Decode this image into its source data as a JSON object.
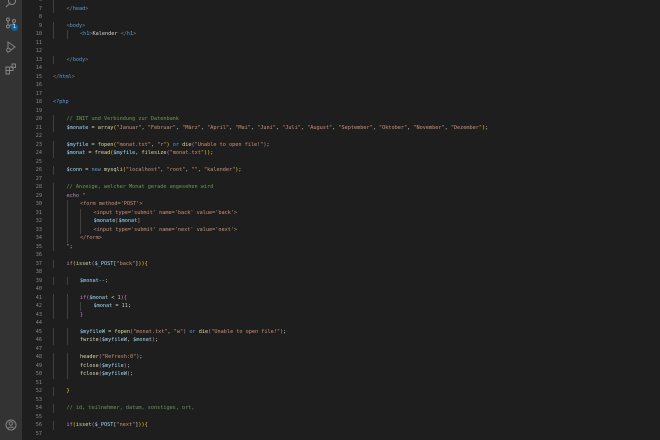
{
  "activity_bar": {
    "icons": [
      "search-icon",
      "source-control-icon",
      "run-debug-icon",
      "extensions-icon",
      "account-icon"
    ],
    "source_control_badge": "1"
  },
  "editor": {
    "language": "php",
    "lines": [
      {
        "n": "6",
        "indent": 1,
        "tokens": [
          [
            "",
            "t-default"
          ]
        ]
      },
      {
        "n": "7",
        "indent": 1,
        "tokens": [
          [
            "</",
            "t-punct"
          ],
          [
            "head",
            "t-tag"
          ],
          [
            ">",
            "t-punct"
          ]
        ]
      },
      {
        "n": "8",
        "indent": 0,
        "tokens": [
          [
            "",
            "t-default"
          ]
        ]
      },
      {
        "n": "9",
        "indent": 1,
        "tokens": [
          [
            "<",
            "t-punct"
          ],
          [
            "body",
            "t-tag"
          ],
          [
            ">",
            "t-punct"
          ]
        ]
      },
      {
        "n": "10",
        "indent": 2,
        "tokens": [
          [
            "<",
            "t-punct"
          ],
          [
            "h1",
            "t-tag"
          ],
          [
            ">",
            "t-punct"
          ],
          [
            "Kalender ",
            "t-default"
          ],
          [
            "</",
            "t-punct"
          ],
          [
            "h1",
            "t-tag"
          ],
          [
            ">",
            "t-punct"
          ]
        ]
      },
      {
        "n": "11",
        "indent": 0,
        "tokens": [
          [
            "",
            "t-default"
          ]
        ]
      },
      {
        "n": "12",
        "indent": 0,
        "tokens": [
          [
            "",
            "t-default"
          ]
        ]
      },
      {
        "n": "13",
        "indent": 1,
        "tokens": [
          [
            "</",
            "t-punct"
          ],
          [
            "body",
            "t-tag"
          ],
          [
            ">",
            "t-punct"
          ]
        ]
      },
      {
        "n": "14",
        "indent": 0,
        "tokens": [
          [
            "",
            "t-default"
          ]
        ]
      },
      {
        "n": "15",
        "indent": 0,
        "tokens": [
          [
            "</",
            "t-punct"
          ],
          [
            "html",
            "t-tag"
          ],
          [
            ">",
            "t-punct"
          ]
        ]
      },
      {
        "n": "16",
        "indent": 0,
        "tokens": [
          [
            "",
            "t-default"
          ]
        ]
      },
      {
        "n": "17",
        "indent": 0,
        "tokens": [
          [
            "",
            "t-default"
          ]
        ]
      },
      {
        "n": "18",
        "indent": 0,
        "tokens": [
          [
            "<?php",
            "t-kw2"
          ]
        ]
      },
      {
        "n": "19",
        "indent": 0,
        "tokens": [
          [
            "",
            "t-default"
          ]
        ]
      },
      {
        "n": "20",
        "indent": 1,
        "tokens": [
          [
            "// INIT und Verbindung zur Datenbank",
            "t-cmt"
          ]
        ]
      },
      {
        "n": "21",
        "indent": 1,
        "tokens": [
          [
            "$monate",
            "t-var"
          ],
          [
            " = ",
            "t-default"
          ],
          [
            "array",
            "t-fn"
          ],
          [
            "(",
            "t-brk"
          ],
          [
            "\"Januar\"",
            "t-str"
          ],
          [
            ", ",
            "t-default"
          ],
          [
            "\"Februar\"",
            "t-str"
          ],
          [
            ", ",
            "t-default"
          ],
          [
            "\"März\"",
            "t-str"
          ],
          [
            ", ",
            "t-default"
          ],
          [
            "\"April\"",
            "t-str"
          ],
          [
            ", ",
            "t-default"
          ],
          [
            "\"Mai\"",
            "t-str"
          ],
          [
            ", ",
            "t-default"
          ],
          [
            "\"Juni\"",
            "t-str"
          ],
          [
            ", ",
            "t-default"
          ],
          [
            "\"Juli\"",
            "t-str"
          ],
          [
            ", ",
            "t-default"
          ],
          [
            "\"August\"",
            "t-str"
          ],
          [
            ", ",
            "t-default"
          ],
          [
            "\"September\"",
            "t-str"
          ],
          [
            ", ",
            "t-default"
          ],
          [
            "\"Oktober\"",
            "t-str"
          ],
          [
            ", ",
            "t-default"
          ],
          [
            "\"November\"",
            "t-str"
          ],
          [
            ", ",
            "t-default"
          ],
          [
            "\"Dezember\"",
            "t-str"
          ],
          [
            ")",
            "t-brk"
          ],
          [
            ";",
            "t-default"
          ]
        ]
      },
      {
        "n": "22",
        "indent": 0,
        "tokens": [
          [
            "",
            "t-default"
          ]
        ]
      },
      {
        "n": "23",
        "indent": 1,
        "tokens": [
          [
            "$myfile",
            "t-var"
          ],
          [
            " = ",
            "t-default"
          ],
          [
            "fopen",
            "t-fn"
          ],
          [
            "(",
            "t-brk"
          ],
          [
            "\"monat.txt\"",
            "t-str"
          ],
          [
            ", ",
            "t-default"
          ],
          [
            "\"r\"",
            "t-str"
          ],
          [
            ") ",
            "t-brk"
          ],
          [
            "or ",
            "t-kw2"
          ],
          [
            "die",
            "t-fn"
          ],
          [
            "(",
            "t-kw"
          ],
          [
            "\"Unable to open file!\"",
            "t-str"
          ],
          [
            ")",
            "t-kw"
          ],
          [
            ";",
            "t-default"
          ]
        ]
      },
      {
        "n": "24",
        "indent": 1,
        "tokens": [
          [
            "$monat",
            "t-var"
          ],
          [
            " = ",
            "t-default"
          ],
          [
            "fread",
            "t-fn"
          ],
          [
            "(",
            "t-brk"
          ],
          [
            "$myfile",
            "t-var"
          ],
          [
            ", ",
            "t-default"
          ],
          [
            "filesize",
            "t-fn"
          ],
          [
            "(",
            "t-kw"
          ],
          [
            "\"monat.txt\"",
            "t-str"
          ],
          [
            "))",
            "t-brk"
          ],
          [
            ";",
            "t-default"
          ]
        ]
      },
      {
        "n": "25",
        "indent": 0,
        "tokens": [
          [
            "",
            "t-default"
          ]
        ]
      },
      {
        "n": "26",
        "indent": 1,
        "tokens": [
          [
            "$conn",
            "t-var"
          ],
          [
            " = ",
            "t-default"
          ],
          [
            "new ",
            "t-kw2"
          ],
          [
            "mysqli",
            "t-fn"
          ],
          [
            "(",
            "t-brk"
          ],
          [
            "\"localhost\"",
            "t-str"
          ],
          [
            ", ",
            "t-default"
          ],
          [
            "\"root\"",
            "t-str"
          ],
          [
            ", ",
            "t-default"
          ],
          [
            "\"\"",
            "t-str"
          ],
          [
            ", ",
            "t-default"
          ],
          [
            "\"kalender\"",
            "t-str"
          ],
          [
            ")",
            "t-brk"
          ],
          [
            ";",
            "t-default"
          ]
        ]
      },
      {
        "n": "27",
        "indent": 0,
        "tokens": [
          [
            "",
            "t-default"
          ]
        ]
      },
      {
        "n": "28",
        "indent": 1,
        "tokens": [
          [
            "// Anzeige, welcher Monat gerade angesehen wird",
            "t-cmt"
          ]
        ]
      },
      {
        "n": "29",
        "indent": 1,
        "tokens": [
          [
            "echo ",
            "t-kw"
          ],
          [
            "\"",
            "t-str"
          ]
        ]
      },
      {
        "n": "30",
        "indent": 2,
        "tokens": [
          [
            "<form method='POST'>",
            "t-str"
          ]
        ]
      },
      {
        "n": "31",
        "indent": 3,
        "tokens": [
          [
            "<input type='submit' name='back' value='back'>",
            "t-str"
          ]
        ]
      },
      {
        "n": "32",
        "indent": 3,
        "tokens": [
          [
            "$monate",
            "t-var"
          ],
          [
            "[",
            "t-str"
          ],
          [
            "$monat",
            "t-var"
          ],
          [
            "]",
            "t-str"
          ]
        ]
      },
      {
        "n": "33",
        "indent": 3,
        "tokens": [
          [
            "<input type='submit' name='next' value='next'>",
            "t-str"
          ]
        ]
      },
      {
        "n": "34",
        "indent": 2,
        "tokens": [
          [
            "</form>",
            "t-str"
          ]
        ]
      },
      {
        "n": "35",
        "indent": 1,
        "tokens": [
          [
            "\"",
            "t-str"
          ],
          [
            ";",
            "t-default"
          ]
        ]
      },
      {
        "n": "36",
        "indent": 0,
        "tokens": [
          [
            "",
            "t-default"
          ]
        ]
      },
      {
        "n": "37",
        "indent": 1,
        "tokens": [
          [
            "if",
            "t-kw"
          ],
          [
            "(",
            "t-brk"
          ],
          [
            "isset",
            "t-fn"
          ],
          [
            "(",
            "t-kw"
          ],
          [
            "$_POST",
            "t-var"
          ],
          [
            "[",
            "t-default"
          ],
          [
            "\"back\"",
            "t-str"
          ],
          [
            "]",
            "t-default"
          ],
          [
            "))",
            "t-brk"
          ],
          [
            "{",
            "t-brk"
          ]
        ]
      },
      {
        "n": "38",
        "indent": 0,
        "tokens": [
          [
            "",
            "t-default"
          ]
        ]
      },
      {
        "n": "39",
        "indent": 2,
        "tokens": [
          [
            "$monat",
            "t-var"
          ],
          [
            "--",
            "t-default"
          ],
          [
            ";",
            "t-default"
          ]
        ]
      },
      {
        "n": "40",
        "indent": 0,
        "tokens": [
          [
            "",
            "t-default"
          ]
        ]
      },
      {
        "n": "41",
        "indent": 2,
        "tokens": [
          [
            "if",
            "t-kw"
          ],
          [
            "(",
            "t-kw"
          ],
          [
            "$monat",
            "t-var"
          ],
          [
            " < ",
            "t-default"
          ],
          [
            "1",
            "t-num"
          ],
          [
            ")",
            "t-kw"
          ],
          [
            "{",
            "t-kw"
          ]
        ]
      },
      {
        "n": "42",
        "indent": 3,
        "tokens": [
          [
            "$monat",
            "t-var"
          ],
          [
            " = ",
            "t-default"
          ],
          [
            "11",
            "t-num"
          ],
          [
            ";",
            "t-default"
          ]
        ]
      },
      {
        "n": "43",
        "indent": 2,
        "tokens": [
          [
            "}",
            "t-kw"
          ]
        ]
      },
      {
        "n": "44",
        "indent": 0,
        "tokens": [
          [
            "",
            "t-default"
          ]
        ]
      },
      {
        "n": "45",
        "indent": 2,
        "tokens": [
          [
            "$myfileW",
            "t-var"
          ],
          [
            " = ",
            "t-default"
          ],
          [
            "fopen",
            "t-fn"
          ],
          [
            "(",
            "t-kw"
          ],
          [
            "\"monat.txt\"",
            "t-str"
          ],
          [
            ", ",
            "t-default"
          ],
          [
            "\"w\"",
            "t-str"
          ],
          [
            ") ",
            "t-kw"
          ],
          [
            "or ",
            "t-kw2"
          ],
          [
            "die",
            "t-fn"
          ],
          [
            "(",
            "t-kw"
          ],
          [
            "\"Unable to open file!\"",
            "t-str"
          ],
          [
            ")",
            "t-kw"
          ],
          [
            ";",
            "t-default"
          ]
        ]
      },
      {
        "n": "46",
        "indent": 2,
        "tokens": [
          [
            "fwrite",
            "t-fn"
          ],
          [
            "(",
            "t-kw"
          ],
          [
            "$myfileW",
            "t-var"
          ],
          [
            ", ",
            "t-default"
          ],
          [
            "$monat",
            "t-var"
          ],
          [
            ")",
            "t-kw"
          ],
          [
            ";",
            "t-default"
          ]
        ]
      },
      {
        "n": "47",
        "indent": 0,
        "tokens": [
          [
            "",
            "t-default"
          ]
        ]
      },
      {
        "n": "48",
        "indent": 2,
        "tokens": [
          [
            "header",
            "t-fn"
          ],
          [
            "(",
            "t-kw"
          ],
          [
            "\"Refresh:0\"",
            "t-str"
          ],
          [
            ")",
            "t-kw"
          ],
          [
            ";",
            "t-default"
          ]
        ]
      },
      {
        "n": "49",
        "indent": 2,
        "tokens": [
          [
            "fclose",
            "t-fn"
          ],
          [
            "(",
            "t-kw"
          ],
          [
            "$myfile",
            "t-var"
          ],
          [
            ")",
            "t-kw"
          ],
          [
            ";",
            "t-default"
          ]
        ]
      },
      {
        "n": "50",
        "indent": 2,
        "tokens": [
          [
            "fclose",
            "t-fn"
          ],
          [
            "(",
            "t-kw"
          ],
          [
            "$myfileW",
            "t-var"
          ],
          [
            ")",
            "t-kw"
          ],
          [
            ";",
            "t-default"
          ]
        ]
      },
      {
        "n": "51",
        "indent": 0,
        "tokens": [
          [
            "",
            "t-default"
          ]
        ]
      },
      {
        "n": "52",
        "indent": 1,
        "tokens": [
          [
            "}",
            "t-brk"
          ]
        ]
      },
      {
        "n": "53",
        "indent": 0,
        "tokens": [
          [
            "",
            "t-default"
          ]
        ]
      },
      {
        "n": "54",
        "indent": 1,
        "tokens": [
          [
            "// id, teilnehmer, datum, sonstiges, ort,",
            "t-cmt"
          ]
        ]
      },
      {
        "n": "55",
        "indent": 0,
        "tokens": [
          [
            "",
            "t-default"
          ]
        ]
      },
      {
        "n": "56",
        "indent": 1,
        "tokens": [
          [
            "if",
            "t-kw"
          ],
          [
            "(",
            "t-brk"
          ],
          [
            "isset",
            "t-fn"
          ],
          [
            "(",
            "t-kw"
          ],
          [
            "$_POST",
            "t-var"
          ],
          [
            "[",
            "t-default"
          ],
          [
            "\"next\"",
            "t-str"
          ],
          [
            "]",
            "t-default"
          ],
          [
            "))",
            "t-brk"
          ],
          [
            "{",
            "t-brk"
          ]
        ]
      },
      {
        "n": "57",
        "indent": 0,
        "tokens": [
          [
            "",
            "t-default"
          ]
        ]
      }
    ]
  }
}
